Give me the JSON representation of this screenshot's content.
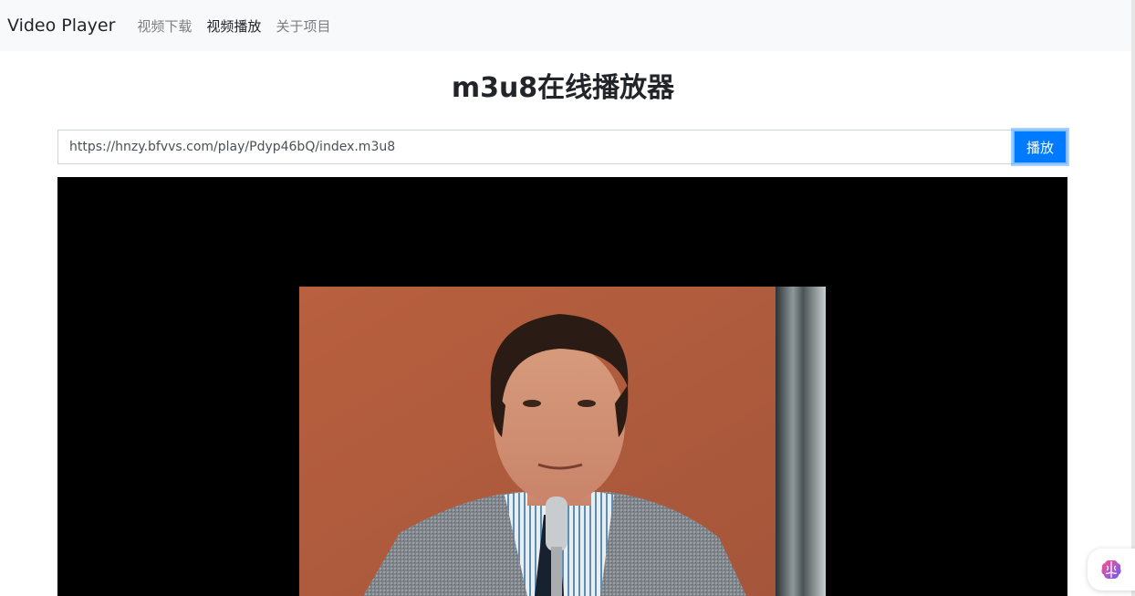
{
  "navbar": {
    "brand": "Video Player",
    "links": [
      {
        "label": "视频下载",
        "active": false
      },
      {
        "label": "视频播放",
        "active": true
      },
      {
        "label": "关于项目",
        "active": false
      }
    ]
  },
  "main": {
    "title": "m3u8在线播放器",
    "url_value": "https://hnzy.bfvvs.com/play/Pdyp46bQ/index.m3u8",
    "play_label": "播放"
  },
  "video": {
    "frame_content": "man-with-microphone"
  },
  "widget": {
    "icon": "brain-icon"
  },
  "colors": {
    "navbar_bg": "#f8f9fa",
    "primary": "#007bff",
    "video_bg": "#000000",
    "frame_backdrop": "#b35e40"
  }
}
